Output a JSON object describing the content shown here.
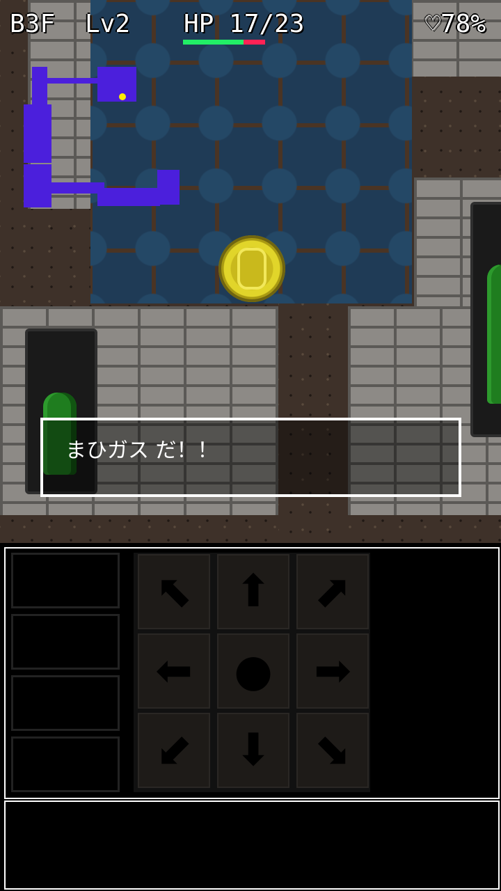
{
  "hud": {
    "floor": "B3F",
    "level": "Lv2",
    "hp_text": "HP 17/23",
    "hp_current": 17,
    "hp_max": 23,
    "satiety": "♡78%"
  },
  "message": "まひガス だ！！",
  "items": {
    "coin": "gold-coin-icon",
    "plants": [
      "plant-icon",
      "plant-icon"
    ]
  },
  "minimap": {
    "color": "#4b1fdc",
    "player_marker_color": "#ffee00"
  },
  "dpad": [
    {
      "name": "up-left",
      "glyph": "⬉"
    },
    {
      "name": "up",
      "glyph": "⬆"
    },
    {
      "name": "up-right",
      "glyph": "⬈"
    },
    {
      "name": "left",
      "glyph": "⬅"
    },
    {
      "name": "wait",
      "glyph": "●"
    },
    {
      "name": "right",
      "glyph": "➡"
    },
    {
      "name": "down-left",
      "glyph": "⬋"
    },
    {
      "name": "down",
      "glyph": "⬇"
    },
    {
      "name": "down-right",
      "glyph": "⬊"
    }
  ],
  "item_slots": [
    "",
    "",
    "",
    ""
  ]
}
